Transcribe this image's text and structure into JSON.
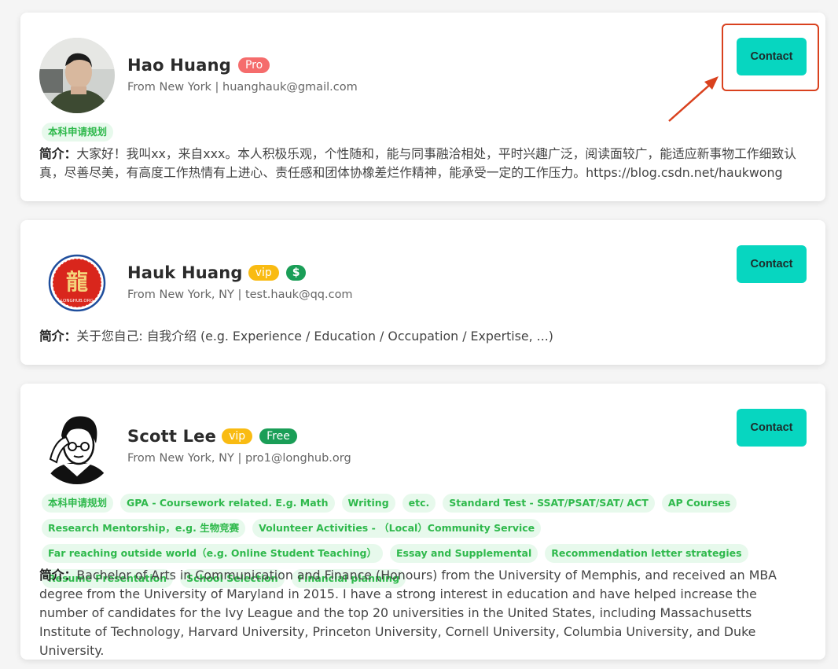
{
  "cards": [
    {
      "name": "Hao Huang",
      "badges": [
        "Pro"
      ],
      "subtitle": "From New York | huanghauk@gmail.com",
      "contact_label": "Contact",
      "tags": [
        "本科申请规划"
      ],
      "bio_label": "简介：",
      "bio_text": "大家好！我叫xx，来自xxx。本人积极乐观，个性随和，能与同事融洽相处，平时兴趣广泛，阅读面较广，能适应新事物工作细致认真，尽善尽美，有高度工作热情有上进心、责任感和团体协橡差烂作精神，能承受一定的工作压力。https://blog.csdn.net/haukwong",
      "avatar": "person-photo"
    },
    {
      "name": "Hauk Huang",
      "badges": [
        "vip",
        "$"
      ],
      "subtitle": "From New York, NY | test.hauk@qq.com",
      "contact_label": "Contact",
      "tags": [],
      "bio_label": "简介：",
      "bio_text": "关于您自己: 自我介绍 (e.g. Experience / Education / Occupation / Expertise, ...)",
      "avatar": "dragon-logo",
      "logo_text": "LONGHUB.ORG"
    },
    {
      "name": "Scott Lee",
      "badges": [
        "vip",
        "Free"
      ],
      "subtitle": "From New York, NY | pro1@longhub.org",
      "contact_label": "Contact",
      "tags": [
        "本科申请规划",
        "GPA - Coursework related. E.g. Math",
        "Writing",
        "etc.",
        "Standard Test - SSAT/PSAT/SAT/ ACT",
        "AP Courses",
        "Research Mentorship，e.g. 生物竞赛",
        "Volunteer Activities - （Local）Community Service",
        "Far reaching outside world（e.g. Online Student Teaching）",
        "Essay and Supplemental",
        "Recommendation letter strategies",
        "Resume Presentation",
        "School Selection",
        "Financial planning"
      ],
      "bio_label": "简介：",
      "bio_text": "Bachelor of Arts in Communication and Finance (Honours) from the University of Memphis, and received an MBA degree from the University of Maryland in 2015. I have a strong interest in education and have helped increase the number of candidates for the Ivy League and the top 20 universities in the United States, including Massachusetts Institute of Technology, Harvard University, Princeton University, Cornell University, Columbia University, and Duke University.",
      "avatar": "sketch-portrait"
    }
  ],
  "colors": {
    "contact_button": "#07d6c0",
    "pro_badge": "#f56c6c",
    "vip_badge": "#f9bb12",
    "green_badge": "#1a9e57",
    "tag_bg": "#e7f9ec",
    "tag_text": "#2fb94c",
    "annotation": "#d9411e"
  }
}
